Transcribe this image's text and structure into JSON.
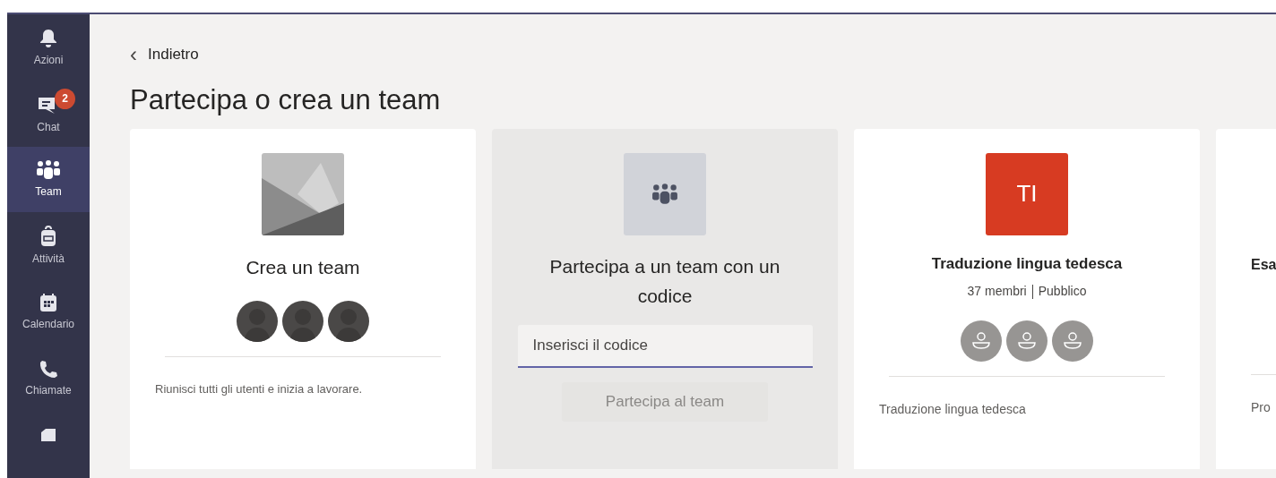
{
  "sidebar": {
    "items": [
      {
        "label": "Azioni",
        "selected": false
      },
      {
        "label": "Chat",
        "selected": false,
        "badge": "2"
      },
      {
        "label": "Team",
        "selected": true
      },
      {
        "label": "Attività",
        "selected": false
      },
      {
        "label": "Calendario",
        "selected": false
      },
      {
        "label": "Chiamate",
        "selected": false
      },
      {
        "selected": false
      }
    ]
  },
  "back_link": {
    "icon": "‹",
    "label": "Indietro"
  },
  "page_title": "Partecipa o crea un team",
  "cards": [
    {
      "kind": "create",
      "title": "Crea un team",
      "description": "Riunisci tutti gli utenti e inizia a lavorare."
    },
    {
      "kind": "join",
      "title": "Partecipa a un team con un codice",
      "placeholder": "Inserisci il codice",
      "button": {
        "label": "Partecipa al team",
        "disabled": true
      }
    },
    {
      "kind": "team",
      "initials": "TI",
      "color": "#d73b22",
      "title": "Traduzione lingua tedesca",
      "members": "37 membri",
      "visibility": "Pubblico",
      "description": "Traduzione lingua tedesca"
    },
    {
      "kind": "partial",
      "title": "Esa",
      "description": "Pro"
    }
  ]
}
